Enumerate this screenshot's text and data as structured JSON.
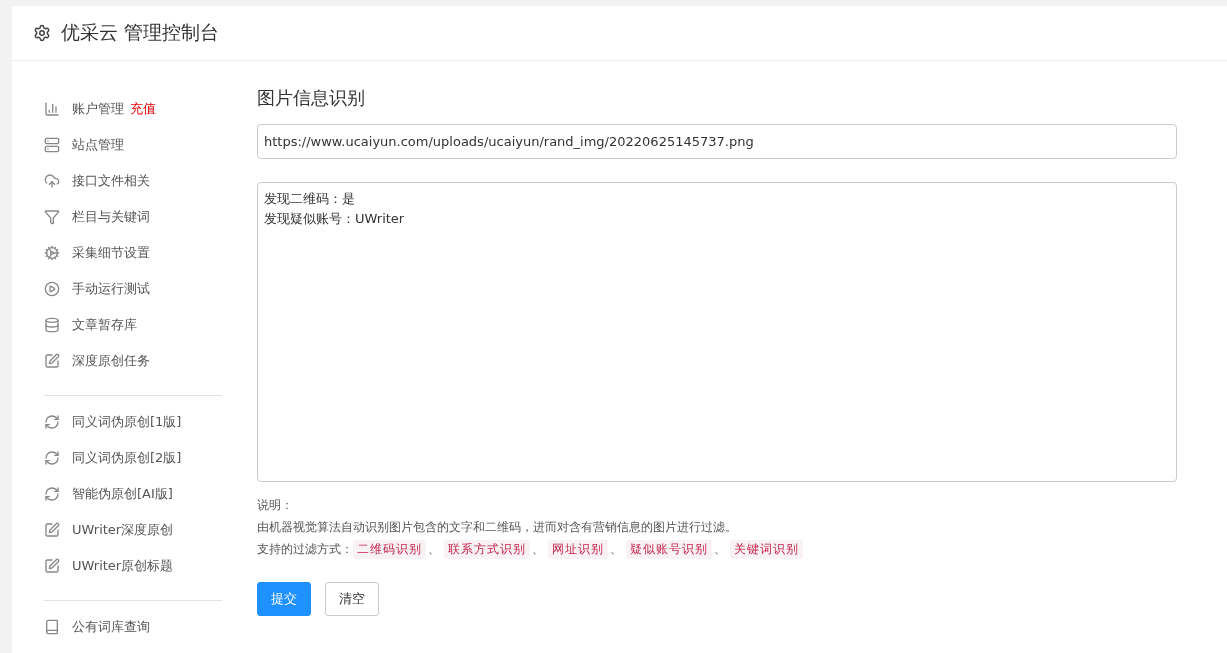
{
  "header": {
    "title": "优采云 管理控制台"
  },
  "sidebar": {
    "sections": [
      {
        "items": [
          {
            "label": "账户管理",
            "badge": "充值"
          },
          {
            "label": "站点管理"
          },
          {
            "label": "接口文件相关"
          },
          {
            "label": "栏目与关键词"
          },
          {
            "label": "采集细节设置"
          },
          {
            "label": "手动运行测试"
          },
          {
            "label": "文章暂存库"
          },
          {
            "label": "深度原创任务"
          }
        ]
      },
      {
        "items": [
          {
            "label": "同义词伪原创[1版]"
          },
          {
            "label": "同义词伪原创[2版]"
          },
          {
            "label": "智能伪原创[AI版]"
          },
          {
            "label": "UWriter深度原创"
          },
          {
            "label": "UWriter原创标题"
          }
        ]
      },
      {
        "items": [
          {
            "label": "公有词库查询"
          }
        ]
      }
    ]
  },
  "main": {
    "title": "图片信息识别",
    "url_field": {
      "value": "https://www.ucaiyun.com/uploads/ucaiyun/rand_img/20220625145737.png"
    },
    "result_box": {
      "lines": [
        "发现二维码：是",
        "发现疑似账号：UWriter"
      ]
    },
    "notes": {
      "heading": "说明：",
      "description": "由机器视觉算法自动识别图片包含的文字和二维码，进而对含有营销信息的图片进行过滤。",
      "methods_label": "支持的过滤方式：",
      "separator": "、",
      "methods": [
        "二维码识别",
        "联系方式识别",
        "网址识别",
        "疑似账号识别",
        "关键词识别"
      ]
    },
    "buttons": [
      {
        "label": "提交",
        "kind": "primary"
      },
      {
        "label": "清空",
        "kind": "default"
      }
    ]
  }
}
